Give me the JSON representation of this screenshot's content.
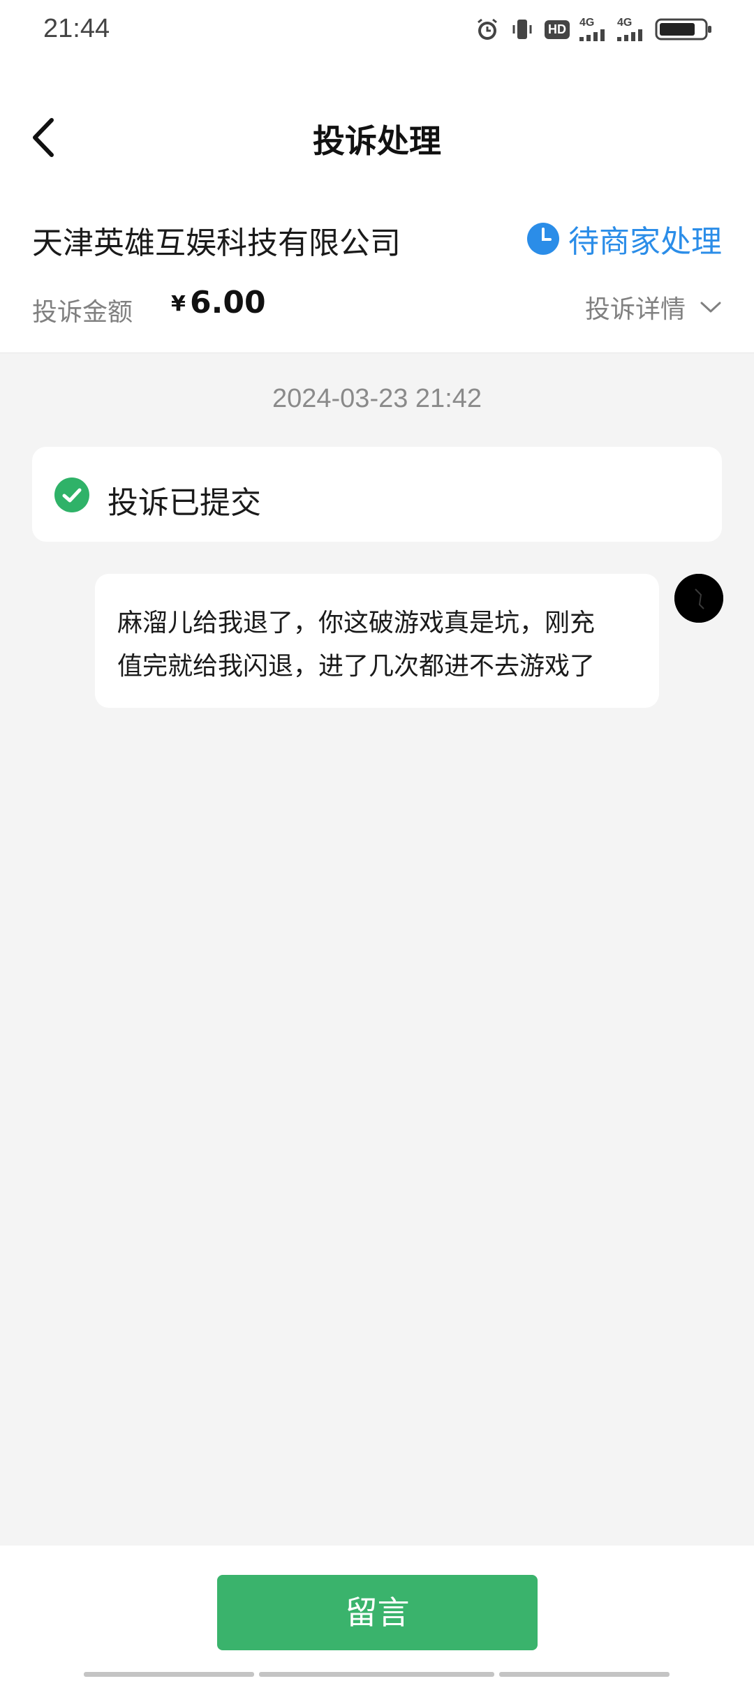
{
  "status_bar": {
    "time": "21:44",
    "icons": [
      "alarm-icon",
      "vibrate-icon",
      "hd-icon",
      "signal-4g-icon",
      "signal-4g-icon",
      "battery-icon"
    ],
    "hd_label": "HD",
    "network_label": "4G"
  },
  "header": {
    "title": "投诉处理",
    "back_icon": "chevron-left-icon"
  },
  "complaint": {
    "merchant": "天津英雄互娱科技有限公司",
    "status": "待商家处理",
    "status_icon": "clock-icon",
    "status_color": "#2b8de8",
    "amount_label": "投诉金额",
    "currency": "¥",
    "amount": "6.00",
    "details_label": "投诉详情",
    "details_icon": "chevron-down-icon"
  },
  "timeline": {
    "timestamp": "2024-03-23 21:42",
    "event": {
      "icon": "check-circle-icon",
      "icon_color": "#2fb268",
      "text": "投诉已提交"
    },
    "message": {
      "lines": [
        "麻溜儿给我退了，你这破游戏真是坑，刚充",
        "值完就给我闪退，进了几次都进不去游戏了"
      ]
    }
  },
  "footer": {
    "button_label": "留言",
    "button_color": "#3ab36c"
  }
}
